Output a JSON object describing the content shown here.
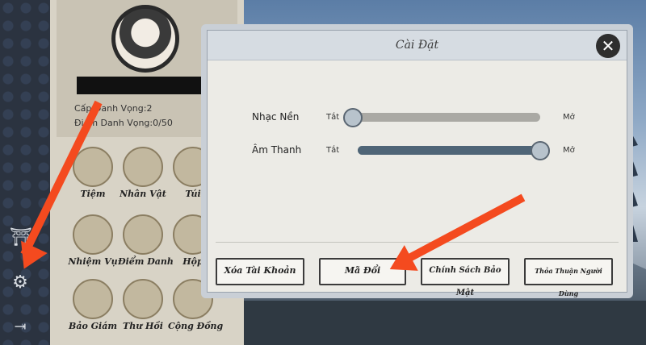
{
  "profile": {
    "level_text": "Cấp Danh Vọng:2",
    "points_text": "Điểm Danh Vọng:0/50"
  },
  "features": [
    {
      "label": "Tiệm"
    },
    {
      "label": "Nhân Vật"
    },
    {
      "label": "Túi"
    },
    {
      "label": "Nhiệm Vụ"
    },
    {
      "label": "Điểm Danh"
    },
    {
      "label": "Hộp"
    },
    {
      "label": "Bảo Giám"
    },
    {
      "label": "Thư Hồi"
    },
    {
      "label": "Cộng Đồng"
    }
  ],
  "dialog": {
    "title": "Cài Đặt",
    "music": {
      "label": "Nhạc Nền",
      "off": "Tắt",
      "on": "Mở",
      "level": 0.0
    },
    "sound": {
      "label": "Âm Thanh",
      "off": "Tắt",
      "on": "Mở",
      "level": 1.0
    },
    "buttons": {
      "delete_account": "Xóa Tài Khoản",
      "redeem_code": "Mã Đổi",
      "privacy_policy": "Chính Sách Bảo Mật",
      "user_agreement": "Thỏa Thuận Người Dùng"
    }
  },
  "icons": {
    "gate": "gate-icon",
    "settings": "gear-icon",
    "logout": "logout-icon",
    "close": "close-icon"
  },
  "colors": {
    "annotation_arrow": "#f44a1f",
    "slider_fill": "#4f6577",
    "slider_empty": "#aaa9a4"
  }
}
